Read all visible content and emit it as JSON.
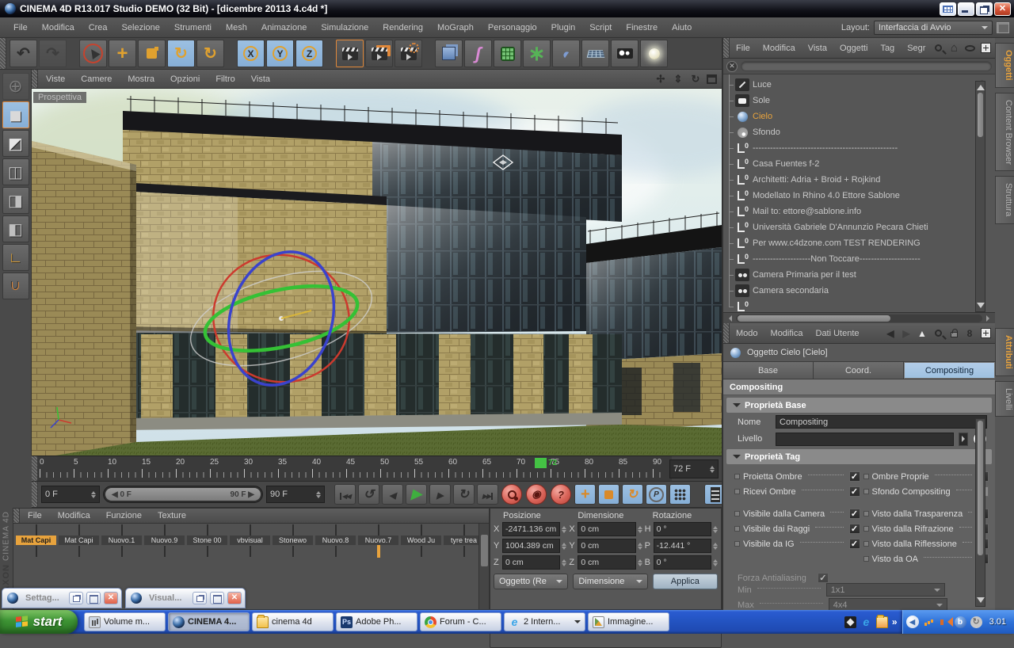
{
  "window": {
    "title": "CINEMA 4D R13.017 Studio DEMO (32 Bit) - [dicembre 20113 4.c4d *]"
  },
  "menubar": {
    "items": [
      "File",
      "Modifica",
      "Crea",
      "Selezione",
      "Strumenti",
      "Mesh",
      "Animazione",
      "Simulazione",
      "Rendering",
      "MoGraph",
      "Personaggio",
      "Plugin",
      "Script",
      "Finestre",
      "Aiuto"
    ],
    "layout_label": "Layout:",
    "layout_value": "Interfaccia di Avvio"
  },
  "toolbar": {
    "tools": [
      {
        "name": "undo-button",
        "type": "undo",
        "glyph": "↶"
      },
      {
        "name": "redo-button",
        "type": "redo",
        "glyph": "↷",
        "disabled": true
      },
      {
        "name": "live-selection-tool",
        "type": "select",
        "glyph": "▶",
        "gap": true
      },
      {
        "name": "move-tool",
        "type": "move",
        "glyph": "+"
      },
      {
        "name": "scale-tool",
        "type": "scale"
      },
      {
        "name": "rotate-tool",
        "type": "rotate",
        "glyph": "↻",
        "active": true
      },
      {
        "name": "rotate-free-tool",
        "type": "rotate2",
        "glyph": "↻"
      },
      {
        "name": "lock-x-axis-button",
        "type": "axisb",
        "letter": "X",
        "active": true,
        "gap": true
      },
      {
        "name": "lock-y-axis-button",
        "type": "axisb",
        "letter": "Y",
        "active": true
      },
      {
        "name": "lock-z-axis-button",
        "type": "axisb",
        "letter": "Z",
        "active": true
      },
      {
        "name": "coordinate-system-button",
        "type": "coords",
        "glyph": "↳"
      },
      {
        "name": "render-view-button",
        "type": "clap1",
        "clap": true,
        "gap": true
      },
      {
        "name": "render-picture-viewer-button",
        "type": "clap2",
        "clap": true
      },
      {
        "name": "render-settings-button",
        "type": "clap3",
        "clap": true
      },
      {
        "name": "add-cube-button",
        "type": "cube",
        "gap": true
      },
      {
        "name": "add-spline-button",
        "type": "spline",
        "glyph": "ʃ"
      },
      {
        "name": "add-subdivision-surface-button",
        "type": "subdiv"
      },
      {
        "name": "add-mograph-button",
        "type": "mograph",
        "glyph": "∗"
      },
      {
        "name": "add-deformer-button",
        "type": "deformer",
        "glyph": "◖"
      },
      {
        "name": "add-floor-button",
        "type": "floor"
      },
      {
        "name": "add-camera-button",
        "type": "camera"
      },
      {
        "name": "add-light-button",
        "type": "light"
      }
    ]
  },
  "left_tools": [
    {
      "name": "make-editable-button",
      "type": "globe",
      "glyph": "⊕",
      "disabled": true
    },
    {
      "name": "model-mode-button",
      "type": "model",
      "glyph": "◼",
      "active": true
    },
    {
      "name": "texture-mode-button",
      "type": "texture",
      "glyph": "◩"
    },
    {
      "name": "point-mode-button",
      "type": "points",
      "glyph": "◫"
    },
    {
      "name": "edge-mode-button",
      "type": "edges",
      "glyph": "◨"
    },
    {
      "name": "polygon-mode-button",
      "type": "polygons",
      "glyph": "◧"
    },
    {
      "name": "axis-mode-button",
      "type": "axis",
      "glyph": "∟"
    },
    {
      "name": "snap-settings-button",
      "type": "magnet",
      "glyph": "∩"
    }
  ],
  "viewport": {
    "menu": [
      "Viste",
      "Camere",
      "Mostra",
      "Opzioni",
      "Filtro",
      "Vista"
    ],
    "label": "Prospettiva"
  },
  "timeline": {
    "labels": [
      "0",
      "5",
      "10",
      "15",
      "20",
      "25",
      "30",
      "35",
      "40",
      "45",
      "50",
      "55",
      "60",
      "65",
      "70",
      "75",
      "80",
      "85",
      "90"
    ],
    "playhead": "72",
    "frame_field": "72 F",
    "current": "0 F",
    "range_start": "0 F",
    "range_end": "90 F",
    "end": "90 F"
  },
  "transport": [
    {
      "name": "goto-start-button",
      "type": "t-start"
    },
    {
      "name": "play-backwards-button",
      "type": "t-pback"
    },
    {
      "name": "previous-frame-button",
      "type": "t-prev"
    },
    {
      "name": "play-button",
      "type": "t-play"
    },
    {
      "name": "next-frame-button",
      "type": "t-next"
    },
    {
      "name": "loop-button",
      "type": "t-loop"
    },
    {
      "name": "goto-end-button",
      "type": "t-end"
    },
    {
      "name": "record-keyframe-button",
      "type": "t-key",
      "red": true
    },
    {
      "name": "autokey-button",
      "type": "t-autokey",
      "red": true
    },
    {
      "name": "keyframe-selection-button",
      "type": "t-help",
      "red": true
    },
    {
      "name": "key-position-toggle",
      "type": "t-move",
      "blue": true
    },
    {
      "name": "key-scale-toggle",
      "type": "t-scale",
      "blue": true
    },
    {
      "name": "key-rotation-toggle",
      "type": "t-rot",
      "blue": true
    },
    {
      "name": "key-parameter-toggle",
      "type": "t-param",
      "blue": true
    },
    {
      "name": "key-pla-toggle",
      "type": "t-grid",
      "blue": true
    },
    {
      "name": "timeline-film-button",
      "type": "t-film",
      "blue": true
    }
  ],
  "brand": {
    "line1": "MAXON",
    "line2": "CINEMA 4D"
  },
  "materials": {
    "menu": [
      "File",
      "Modifica",
      "Funzione",
      "Texture"
    ],
    "row1": [
      {
        "label": "Mat Capi",
        "color": "#95b163",
        "shape": "flat",
        "selected": true
      },
      {
        "label": "Mat Capi",
        "color": "#9a9a9a",
        "shape": "flat"
      },
      {
        "label": "Nuovo.1",
        "color": "#cfcfcf",
        "shape": "sphere"
      },
      {
        "label": "Nuovo.9",
        "color": "#dfe6ea",
        "shape": "sphere"
      },
      {
        "label": "Stone 00",
        "color": "#a89a7a",
        "shape": "sphere"
      },
      {
        "label": "vbvisual",
        "color": "#8a7a6a",
        "shape": "cube"
      },
      {
        "label": "Stonewo",
        "color": "#6b6658",
        "shape": "flat"
      },
      {
        "label": "Nuovo.8",
        "color": "#4a3b30",
        "shape": "sphere"
      },
      {
        "label": "Nuovo.7",
        "color": "#a09050",
        "shape": "sphere"
      },
      {
        "label": "Wood Ju",
        "color": "#7a5238",
        "shape": "sphere"
      },
      {
        "label": "tyre trea",
        "color": "#232323",
        "shape": "sphere"
      }
    ],
    "row2": [
      {
        "color": "#c96a28",
        "shape": "sphere"
      },
      {
        "color": "#555555",
        "shape": "sphere"
      },
      {
        "color": "#d8d8d8",
        "shape": "sphere"
      },
      {
        "color": "#333333",
        "shape": "sphere"
      },
      {
        "color": "#9a9a9a",
        "shape": "sphere"
      },
      {
        "color": "#888888",
        "shape": "sphere"
      },
      {
        "color": "#1a1a1a",
        "shape": "sphere"
      },
      {
        "color": "#aac4dd",
        "shape": "sphere"
      },
      {
        "color": "#e8e8e8",
        "shape": "sphere",
        "selected2": true
      },
      {
        "color": "#6f8f3f",
        "shape": "flat"
      },
      {
        "color": "#2e4a6e",
        "shape": "flat"
      }
    ]
  },
  "coords": {
    "h1": "Posizione",
    "h2": "Dimensione",
    "h3": "Rotazione",
    "rows": [
      {
        "a": "X",
        "av": "-2471.136 cm",
        "b": "X",
        "bv": "0 cm",
        "c": "H",
        "cv": "0 °"
      },
      {
        "a": "Y",
        "av": "1004.389 cm",
        "b": "Y",
        "bv": "0 cm",
        "c": "P",
        "cv": "-12.441 °"
      },
      {
        "a": "Z",
        "av": "0 cm",
        "b": "Z",
        "bv": "0 cm",
        "c": "B",
        "cv": "0 °"
      }
    ],
    "drop1": "Oggetto (Re",
    "drop2": "Dimensione",
    "apply": "Applica"
  },
  "object_manager": {
    "menu": [
      "File",
      "Modifica",
      "Vista",
      "Oggetti",
      "Tag",
      "Segr"
    ],
    "side_tabs": [
      {
        "label": "Oggetti",
        "active": true
      },
      {
        "label": "Content Browser"
      },
      {
        "label": "Struttura"
      }
    ],
    "items": [
      {
        "label": "Luce",
        "icon": "light"
      },
      {
        "label": "Sole",
        "icon": "sun"
      },
      {
        "label": "Cielo",
        "icon": "sky",
        "selected": true
      },
      {
        "label": "Sfondo",
        "icon": "background"
      },
      {
        "label": "--------------------------------------------------",
        "icon": "null"
      },
      {
        "label": "Casa Fuentes  f-2",
        "icon": "null"
      },
      {
        "label": "Architetti: Adria + Broid + Rojkind",
        "icon": "null"
      },
      {
        "label": "Modellato In Rhino 4.0  Ettore Sablone",
        "icon": "null"
      },
      {
        "label": "Mail to: ettore@sablone.info",
        "icon": "null"
      },
      {
        "label": "Università  Gabriele D'Annunzio Pecara Chieti",
        "icon": "null"
      },
      {
        "label": "Per www.c4dzone.com TEST RENDERING",
        "icon": "null"
      },
      {
        "label": "--------------------Non Toccare---------------------",
        "icon": "null"
      },
      {
        "label": "Camera Primaria per il test",
        "icon": "camera"
      },
      {
        "label": "Camera secondaria",
        "icon": "camera"
      },
      {
        "label": "",
        "icon": "null"
      }
    ]
  },
  "attributes": {
    "menu": [
      "Modo",
      "Modifica",
      "Dati Utente"
    ],
    "side_tabs": [
      {
        "label": "Attributi",
        "active": true
      },
      {
        "label": "Livelli"
      }
    ],
    "object_title": "Oggetto Cielo [Cielo]",
    "tabs": [
      {
        "label": "Base"
      },
      {
        "label": "Coord."
      },
      {
        "label": "Compositing",
        "selected": true
      }
    ],
    "section": "Compositing",
    "group1": "Proprietà Base",
    "nome_label": "Nome",
    "nome_value": "Compositing",
    "livello_label": "Livello",
    "group2": "Proprietà Tag",
    "checks_left": [
      {
        "label": "Proietta Ombre",
        "checked": true
      },
      {
        "label": "Ricevi Ombre",
        "checked": true
      },
      {
        "label": "Visibile dalla Camera",
        "checked": true,
        "gap": true
      },
      {
        "label": "Visibile dai Raggi",
        "checked": true
      },
      {
        "label": "Visibile da IG",
        "checked": true
      }
    ],
    "checks_right": [
      {
        "label": "Ombre Proprie",
        "checked": true
      },
      {
        "label": "Sfondo Compositing",
        "checked": false
      },
      {
        "label": "Visto dalla Trasparenza",
        "checked": true,
        "gap": true
      },
      {
        "label": "Visto dalla Rifrazione",
        "checked": true
      },
      {
        "label": "Visto dalla Riflessione",
        "checked": true
      },
      {
        "label": "Visto da OA",
        "checked": true
      }
    ],
    "forza_label": "Forza Antialiasing",
    "min_label": "Min",
    "min_value": "1x1",
    "max_label": "Max",
    "max_value": "4x4"
  },
  "minimized_windows": [
    {
      "label": "Settag..."
    },
    {
      "label": "Visual..."
    }
  ],
  "taskbar": {
    "start_label": "start",
    "tasks": [
      {
        "label": "Volume m...",
        "icon": "volume"
      },
      {
        "label": "CINEMA 4...",
        "icon": "c4d",
        "active": true
      },
      {
        "label": "cinema 4d",
        "icon": "folder"
      },
      {
        "label": "Adobe Ph...",
        "icon": "photoshop"
      },
      {
        "label": "Forum - C...",
        "icon": "chrome"
      },
      {
        "label": "2 Intern...",
        "icon": "ie",
        "group": true
      },
      {
        "label": "Immagine...",
        "icon": "image"
      }
    ],
    "clock": "3.01"
  }
}
